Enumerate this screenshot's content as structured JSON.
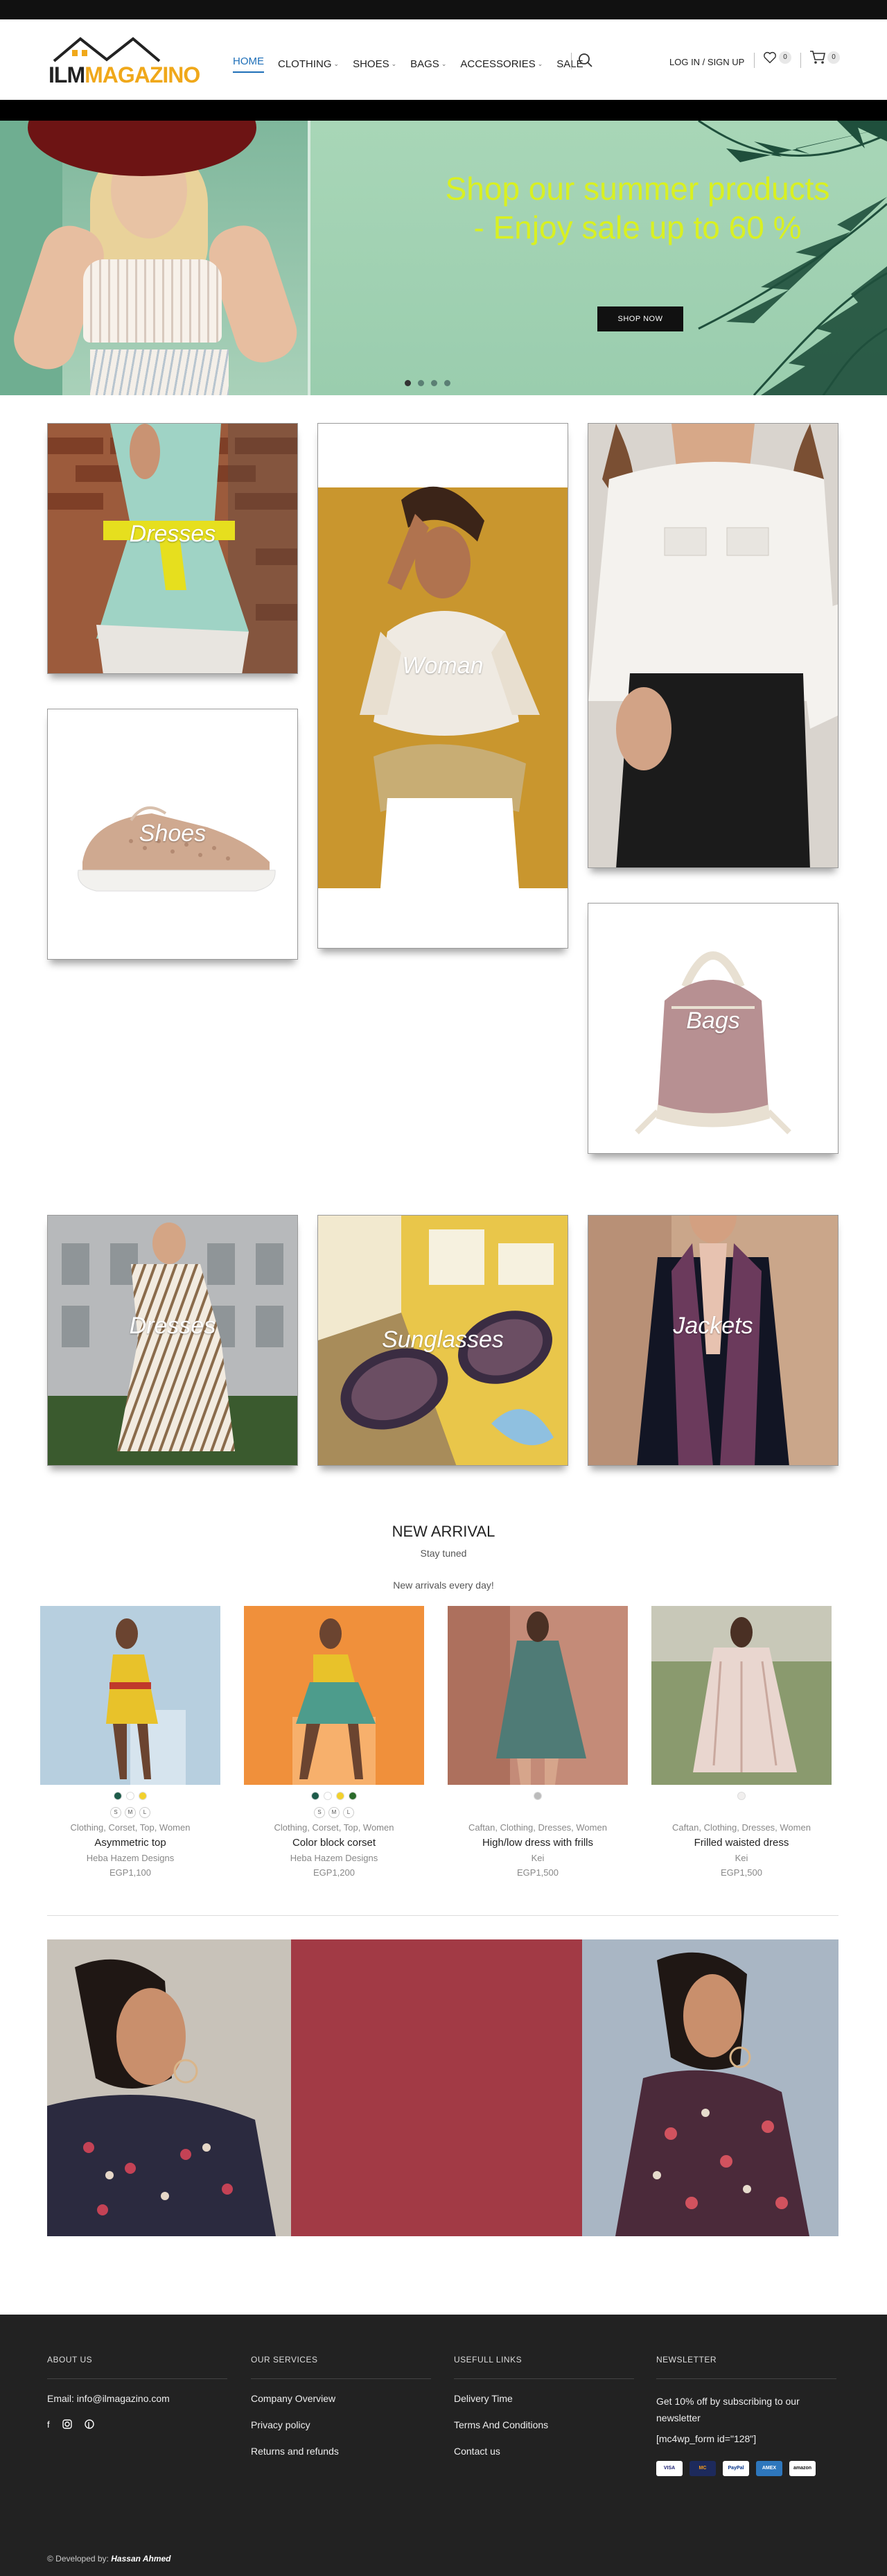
{
  "header": {
    "logo_ilm": "ILM",
    "logo_mag": "AGAZINO",
    "login_label": "LOG IN / SIGN UP",
    "wishlist_count": "0",
    "cart_count": "0"
  },
  "nav": {
    "items": [
      {
        "label": "HOME",
        "caret": false
      },
      {
        "label": "CLOTHING",
        "caret": true
      },
      {
        "label": "SHOES",
        "caret": true
      },
      {
        "label": "BAGS",
        "caret": true
      },
      {
        "label": "ACCESSORIES",
        "caret": true
      },
      {
        "label": "SALE",
        "caret": false
      }
    ]
  },
  "hero": {
    "title": "Shop our summer products - Enjoy sale up to 60 %",
    "button": "SHOP NOW",
    "slides": 4
  },
  "categories": {
    "dresses": "Dresses",
    "woman": "Woman",
    "shoes": "Shoes",
    "bags": "Bags",
    "dresses2": "Dresses",
    "sunglasses": "Sunglasses",
    "jackets": "Jackets"
  },
  "new_arrival": {
    "title": "NEW ARRIVAL",
    "subtitle": "Stay tuned",
    "subtitle2": "New arrivals every day!"
  },
  "products": [
    {
      "categories": "Clothing, Corset, Top, Women",
      "name": "Asymmetric top",
      "brand": "Heba Hazem Designs",
      "price": "EGP1,100",
      "swatches": [
        "#1e5b4a",
        "#ffffff",
        "#f2d12c"
      ],
      "sizes": [
        "S",
        "M",
        "L"
      ]
    },
    {
      "categories": "Clothing, Corset, Top, Women",
      "name": "Color block corset",
      "brand": "Heba Hazem Designs",
      "price": "EGP1,200",
      "swatches": [
        "#1e5b4a",
        "#ffffff",
        "#f2d12c",
        "#2b6b2b"
      ],
      "sizes": [
        "S",
        "M",
        "L"
      ]
    },
    {
      "categories": "Caftan, Clothing, Dresses, Women",
      "name": "High/low dress with frills",
      "brand": "Kei",
      "price": "EGP1,500",
      "swatches": [
        "#bcbcbc"
      ],
      "sizes": []
    },
    {
      "categories": "Caftan, Clothing, Dresses, Women",
      "name": "Frilled waisted dress",
      "brand": "Kei",
      "price": "EGP1,500",
      "swatches": [
        "#f1efee"
      ],
      "sizes": []
    }
  ],
  "footer": {
    "about": {
      "heading": "ABOUT US",
      "email": "Email: info@ilmagazino.com"
    },
    "services": {
      "heading": "OUR SERVICES",
      "links": [
        "Company Overview",
        "Privacy policy",
        "Returns and refunds"
      ]
    },
    "useful": {
      "heading": "USEFULL LINKS",
      "links": [
        "Delivery Time",
        "Terms And Conditions",
        "Contact us"
      ]
    },
    "newsletter": {
      "heading": "NEWSLETTER",
      "text": "Get 10% off by subscribing to our newsletter",
      "shortcode": "[mc4wp_form id=\"128\"]"
    },
    "payments": [
      "VISA",
      "MC",
      "PayPal",
      "AMEX",
      "amazon"
    ],
    "dev_prefix": "© Developed by:",
    "dev_name": "Hassan Ahmed"
  },
  "colors": {
    "accent": "#1e6fb8",
    "hero_text": "#d9f022",
    "footer_bg": "#222222",
    "banner_mid": "#a23a45"
  }
}
